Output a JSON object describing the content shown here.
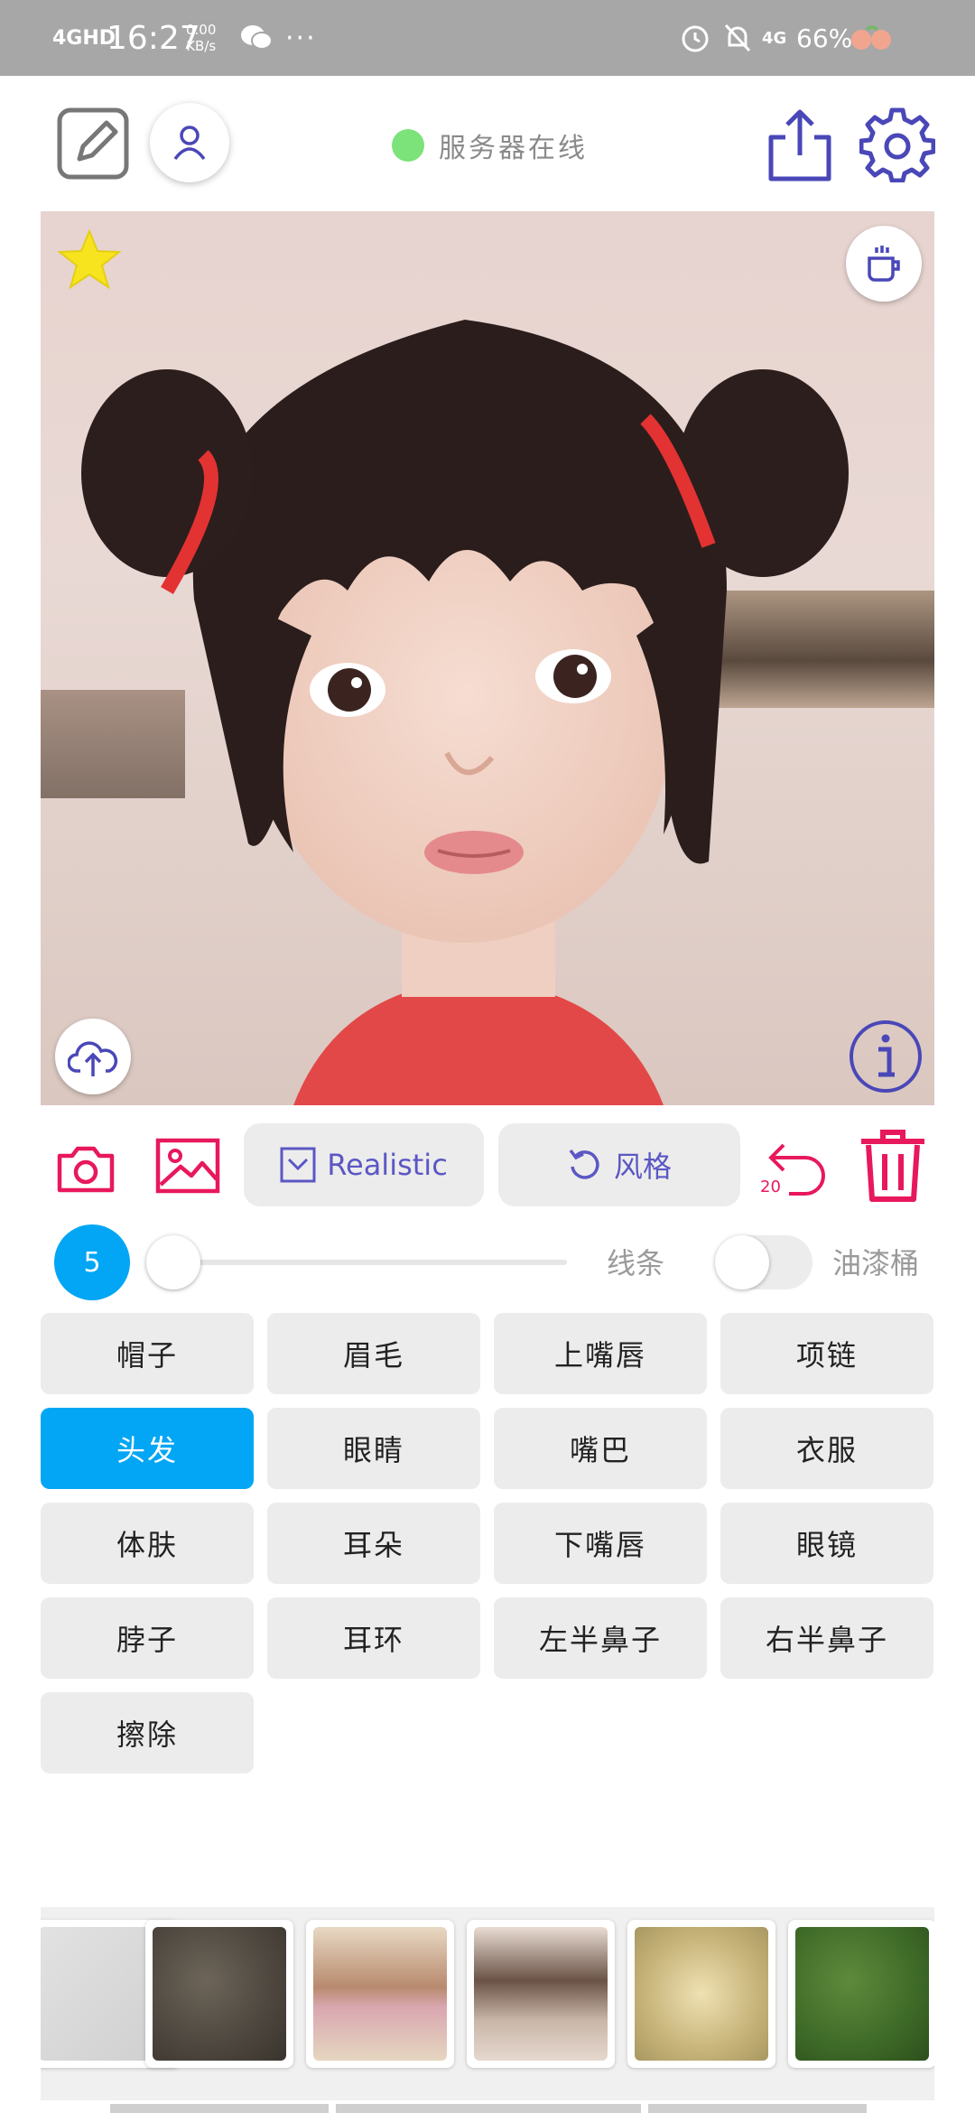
{
  "status_bar": {
    "network": "4GHD",
    "time": "16:27",
    "speed_value": "0.00",
    "speed_unit": "KB/s",
    "dots": "···",
    "signal_4g": "4G",
    "battery": "66%"
  },
  "header": {
    "server_status": "服务器在线"
  },
  "toolbar": {
    "style_select_label": "Realistic",
    "style_label": "风格",
    "undo_count": "20"
  },
  "brush": {
    "size": "5",
    "line_label": "线条",
    "bucket_label": "油漆桶",
    "bucket_enabled": false
  },
  "parts": [
    {
      "label": "帽子",
      "selected": false
    },
    {
      "label": "眉毛",
      "selected": false
    },
    {
      "label": "上嘴唇",
      "selected": false
    },
    {
      "label": "项链",
      "selected": false
    },
    {
      "label": "头发",
      "selected": true
    },
    {
      "label": "眼睛",
      "selected": false
    },
    {
      "label": "嘴巴",
      "selected": false
    },
    {
      "label": "衣服",
      "selected": false
    },
    {
      "label": "体肤",
      "selected": false
    },
    {
      "label": "耳朵",
      "selected": false
    },
    {
      "label": "下嘴唇",
      "selected": false
    },
    {
      "label": "眼镜",
      "selected": false
    },
    {
      "label": "脖子",
      "selected": false
    },
    {
      "label": "耳环",
      "selected": false
    },
    {
      "label": "左半鼻子",
      "selected": false
    },
    {
      "label": "右半鼻子",
      "selected": false
    },
    {
      "label": "擦除",
      "selected": false
    }
  ],
  "colors": {
    "accent_blue": "#03a6f5",
    "icon_purple": "#5b57c4",
    "icon_red": "#e8185c",
    "online_green": "#7ce27a"
  }
}
